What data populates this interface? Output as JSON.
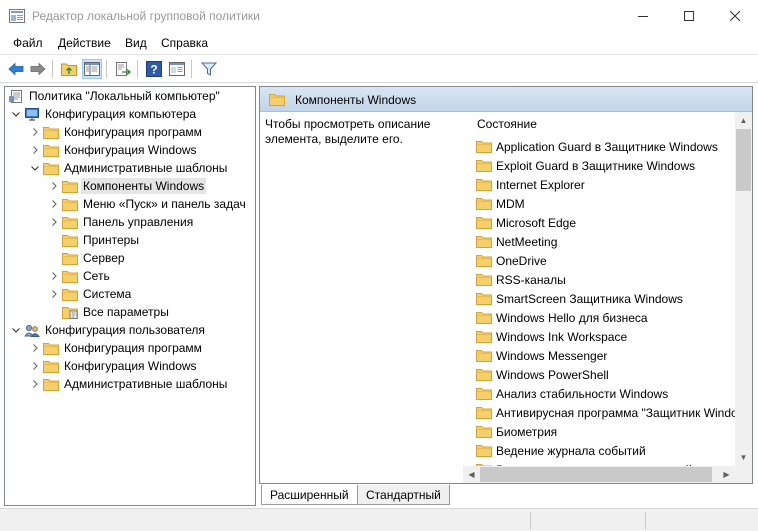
{
  "window": {
    "title": "Редактор локальной групповой политики",
    "controls": {
      "minimize": "—",
      "maximize": "☐",
      "close": "✕"
    }
  },
  "menu": [
    "Файл",
    "Действие",
    "Вид",
    "Справка"
  ],
  "toolbar": {
    "icons": [
      "back-icon",
      "forward-icon",
      "up-folder-icon",
      "show-hide-tree-icon",
      "export-list-icon",
      "help-icon",
      "extended-view-icon",
      "filter-icon"
    ]
  },
  "tree": {
    "root": "Политика \"Локальный компьютер\"",
    "computer_config": "Конфигурация компьютера",
    "cc_programs": "Конфигурация программ",
    "cc_windows": "Конфигурация Windows",
    "cc_admin": "Административные шаблоны",
    "admin_children": [
      "Компоненты Windows",
      "Меню «Пуск» и панель задач",
      "Панель управления",
      "Принтеры",
      "Сервер",
      "Сеть",
      "Система",
      "Все параметры"
    ],
    "user_config": "Конфигурация пользователя",
    "uc_programs": "Конфигурация программ",
    "uc_windows": "Конфигурация Windows",
    "uc_admin": "Административные шаблоны"
  },
  "details": {
    "header_title": "Компоненты Windows",
    "description": "Чтобы просмотреть описание элемента, выделите его.",
    "column_header": "Состояние",
    "items": [
      "Application Guard в Защитнике Windows",
      "Exploit Guard в Защитнике Windows",
      "Internet Explorer",
      "MDM",
      "Microsoft Edge",
      "NetMeeting",
      "OneDrive",
      "RSS-каналы",
      "SmartScreen Защитника Windows",
      "Windows Hello для бизнеса",
      "Windows Ink Workspace",
      "Windows Messenger",
      "Windows PowerShell",
      "Анализ стабильности Windows",
      "Антивирусная программа \"Защитник Windows\"",
      "Биометрия",
      "Ведение журнала событий",
      "Виртуализация средств взаимодействия с приложениями"
    ]
  },
  "tabs": [
    "Расширенный",
    "Стандартный"
  ],
  "colors": {
    "folder": "#f5cf6b",
    "folder_dark": "#d9a933",
    "header_bg": "#c9dbef"
  }
}
